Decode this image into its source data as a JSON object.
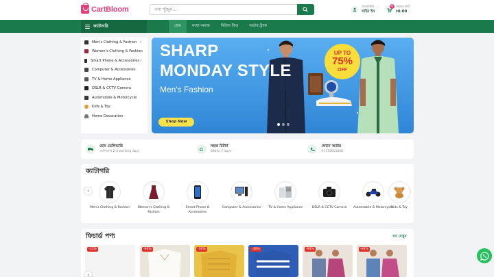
{
  "header": {
    "logo_text": "CartBloom",
    "search_placeholder": "পণ্য খুঁজুন...",
    "account_small": "অ্যাকাউন্ট",
    "account_label": "সাইন ইন",
    "cart_small": "আমার কার্ট",
    "cart_total": "৳0.00",
    "cart_count": "0"
  },
  "nav": {
    "categories_label": "ক্যাটাগরি",
    "links": [
      "হোম",
      "কম্বো অফার",
      "নিউজ ফিড",
      "অর্ডার ট্র্যাক"
    ]
  },
  "sidebar": {
    "items": [
      {
        "label": "Men's Clothing & Fashion",
        "icon": "shirt-icon"
      },
      {
        "label": "Women's Clothing & Fashion",
        "icon": "dress-icon"
      },
      {
        "label": "Smart Phone & Accessories",
        "icon": "phone-icon"
      },
      {
        "label": "Computer & Accessories",
        "icon": "computer-icon"
      },
      {
        "label": "TV & Home Appliance",
        "icon": "tv-icon"
      },
      {
        "label": "DSLR & CCTV Camera",
        "icon": "camera-icon"
      },
      {
        "label": "Automobile & Motorcycle",
        "icon": "motorcycle-icon"
      },
      {
        "label": "Kids & Toy",
        "icon": "toy-icon"
      },
      {
        "label": "Home Decoration",
        "icon": "lamp-icon"
      }
    ]
  },
  "banner": {
    "line1": "SHARP",
    "line2": "MONDAY STYLE",
    "subtitle": "Men's Fashion",
    "button": "Shop Now",
    "promo_top": "UP TO",
    "promo_value": "75%",
    "promo_bottom": "OFF"
  },
  "features": [
    {
      "title": "হোম ডেলিভারি",
      "subtitle": "ডেলিভারি 2-3 working days",
      "icon": "truck-icon"
    },
    {
      "title": "সহজ রিটার্ন",
      "subtitle": "Within 7 days",
      "icon": "return-icon"
    },
    {
      "title": "ফোনে অর্ডার",
      "subtitle": "01775615008",
      "icon": "phone-call-icon"
    }
  ],
  "categories": {
    "title": "ক্যাটাগরি",
    "items": [
      {
        "label": "Men's Clothing & Fashion",
        "icon": "jacket-icon"
      },
      {
        "label": "Women's Clothing & Fashion",
        "icon": "dress-icon"
      },
      {
        "label": "Smart Phone & Accessories",
        "icon": "phone-icon"
      },
      {
        "label": "Computer & Accessories",
        "icon": "computer-icon"
      },
      {
        "label": "TV & Home Appliance",
        "icon": "appliance-icon"
      },
      {
        "label": "DSLR & CCTV Camera",
        "icon": "camera-icon"
      },
      {
        "label": "Automobile & Motorcycle",
        "icon": "motorcycle-icon"
      },
      {
        "label": "Kids & Toy",
        "icon": "teddy-icon"
      }
    ]
  },
  "featured": {
    "title": "ফিচার্ড পণ্য",
    "see_all": "সব দেখুন",
    "products": [
      {
        "badge": "-33%"
      },
      {
        "badge": "-96%"
      },
      {
        "badge": "-36%"
      },
      {
        "badge": "-36%"
      },
      {
        "badge": "-94%"
      },
      {
        "badge": "-94%"
      }
    ]
  },
  "colors": {
    "primary_green": "#1a7a4c",
    "brand_pink": "#e0427a",
    "banner_blue": "#3a94e0",
    "promo_yellow": "#f8dd3b"
  }
}
